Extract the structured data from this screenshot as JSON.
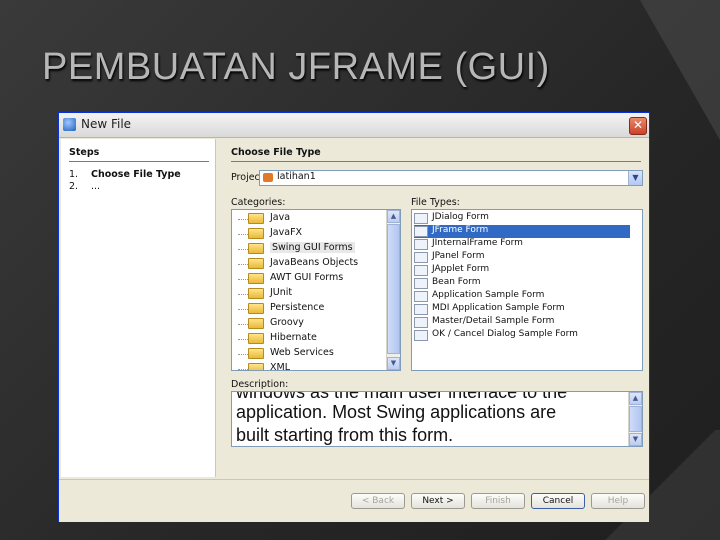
{
  "slide": {
    "title": "PEMBUATAN JFRAME (GUI)"
  },
  "dialog": {
    "title": "New File",
    "close_glyph": "✕",
    "steps": {
      "heading": "Steps",
      "items": [
        {
          "num": "1.",
          "label": "Choose File Type"
        },
        {
          "num": "2.",
          "label": "..."
        }
      ]
    },
    "main_heading": "Choose File Type",
    "project": {
      "label": "Project:",
      "value": "latihan1"
    },
    "categories": {
      "label": "Categories:",
      "items": [
        "Java",
        "JavaFX",
        "Swing GUI Forms",
        "JavaBeans Objects",
        "AWT GUI Forms",
        "JUnit",
        "Persistence",
        "Groovy",
        "Hibernate",
        "Web Services",
        "XML"
      ],
      "selected": "Swing GUI Forms"
    },
    "file_types": {
      "label": "File Types:",
      "items": [
        "JDialog Form",
        "JFrame Form",
        "JInternalFrame Form",
        "JPanel Form",
        "JApplet Form",
        "Bean Form",
        "Application Sample Form",
        "MDI Application Sample Form",
        "Master/Detail Sample Form",
        "OK / Cancel Dialog Sample Form"
      ],
      "selected": "JFrame Form"
    },
    "description": {
      "label": "Description:",
      "lines": [
        "windows as the main user interface to the",
        "application. Most Swing applications are",
        "built starting from this form."
      ]
    },
    "buttons": {
      "back": "< Back",
      "next": "Next >",
      "finish": "Finish",
      "cancel": "Cancel",
      "help": "Help"
    }
  },
  "colors": {
    "selection": "#316ac5",
    "dialog_bg": "#ece9d8",
    "title_text": "#b7b7b7"
  },
  "icons": [
    "app-icon",
    "close-icon",
    "folder-icon",
    "form-icon",
    "chevron-down-icon",
    "scroll-up-icon",
    "scroll-down-icon"
  ]
}
